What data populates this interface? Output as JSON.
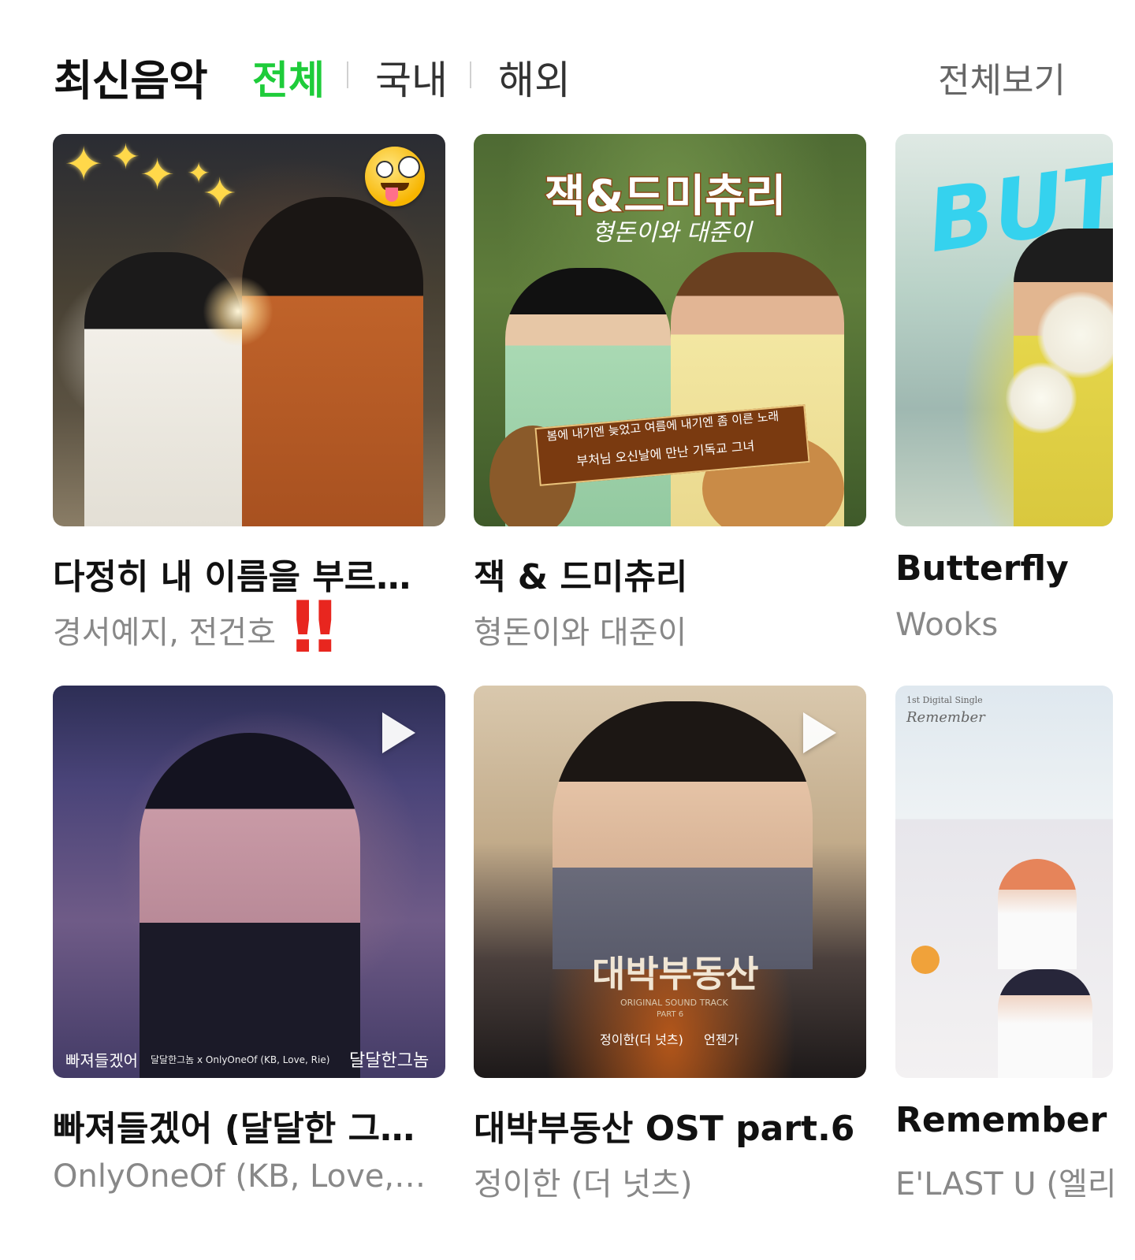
{
  "header": {
    "section_title": "최신음악",
    "tabs": [
      {
        "label": "전체",
        "active": true
      },
      {
        "label": "국내",
        "active": false
      },
      {
        "label": "해외",
        "active": false
      }
    ],
    "view_all_label": "전체보기",
    "accent_color": "#1ecc3a"
  },
  "albums": [
    {
      "title": "다정히 내 이름을 부르…",
      "artist": "경서예지, 전건호",
      "decoration": "red double exclamation ‼"
    },
    {
      "title": "잭 & 드미츄리",
      "artist": "형돈이와 대준이",
      "cover_text": {
        "title": "잭&드미츄리",
        "subtitle": "형돈이와 대준이",
        "line1": "봄에 내기엔 늦었고 여름에 내기엔 좀 이른 노래",
        "line2": "부처님 오신날에 만난 기독교 그녀"
      }
    },
    {
      "title": "Butterfly",
      "artist": "Wooks",
      "cover_text": {
        "title": "BUTTE"
      }
    },
    {
      "title": "빠져들겠어 (달달한 그…",
      "artist": "OnlyOneOf (KB, Love,…",
      "cover_text": {
        "left": "빠져들겠어",
        "credit": "달달한그놈 x OnlyOneOf (KB, Love, Rie)",
        "logo": "달달한그놈"
      }
    },
    {
      "title": "대박부동산 OST part.6",
      "artist": "정이한 (더 넛츠)",
      "cover_text": {
        "title": "대박부동산",
        "ost": "ORIGINAL SOUND TRACK",
        "part": "PART 6",
        "credit_artist": "정이한(더 넛츠)",
        "credit_song": "언젠가"
      }
    },
    {
      "title": "Remember",
      "artist": "E'LAST U (엘리",
      "cover_text": {
        "small": "1st Digital Single",
        "script": "Remember"
      }
    }
  ],
  "icons": {
    "play": "play-icon",
    "emoji": "crazy-face-emoji-icon",
    "sparkles": "sparkles-icon"
  }
}
